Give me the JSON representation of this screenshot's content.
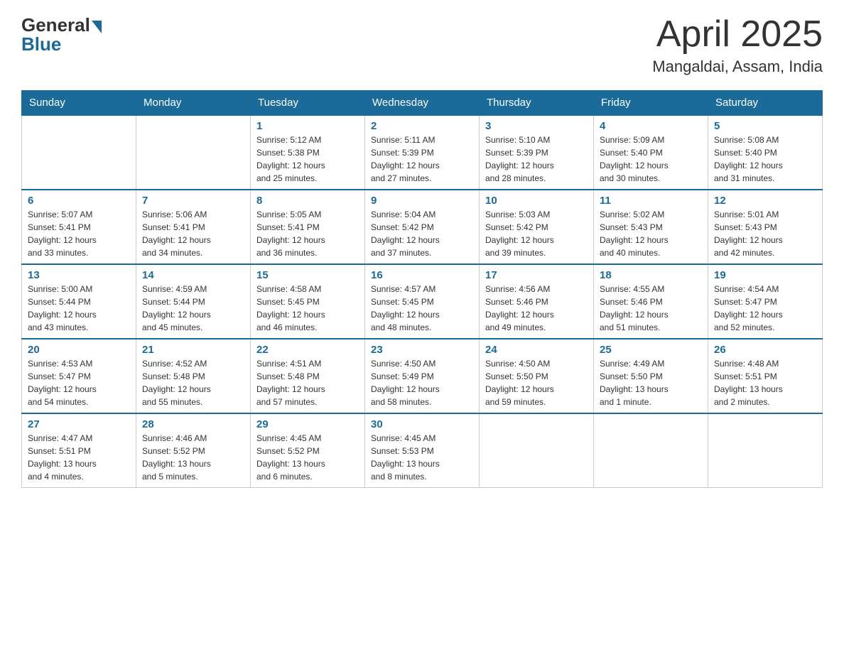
{
  "header": {
    "logo_general": "General",
    "logo_blue": "Blue",
    "title": "April 2025",
    "subtitle": "Mangaldai, Assam, India"
  },
  "weekdays": [
    "Sunday",
    "Monday",
    "Tuesday",
    "Wednesday",
    "Thursday",
    "Friday",
    "Saturday"
  ],
  "weeks": [
    [
      {
        "day": "",
        "info": ""
      },
      {
        "day": "",
        "info": ""
      },
      {
        "day": "1",
        "info": "Sunrise: 5:12 AM\nSunset: 5:38 PM\nDaylight: 12 hours\nand 25 minutes."
      },
      {
        "day": "2",
        "info": "Sunrise: 5:11 AM\nSunset: 5:39 PM\nDaylight: 12 hours\nand 27 minutes."
      },
      {
        "day": "3",
        "info": "Sunrise: 5:10 AM\nSunset: 5:39 PM\nDaylight: 12 hours\nand 28 minutes."
      },
      {
        "day": "4",
        "info": "Sunrise: 5:09 AM\nSunset: 5:40 PM\nDaylight: 12 hours\nand 30 minutes."
      },
      {
        "day": "5",
        "info": "Sunrise: 5:08 AM\nSunset: 5:40 PM\nDaylight: 12 hours\nand 31 minutes."
      }
    ],
    [
      {
        "day": "6",
        "info": "Sunrise: 5:07 AM\nSunset: 5:41 PM\nDaylight: 12 hours\nand 33 minutes."
      },
      {
        "day": "7",
        "info": "Sunrise: 5:06 AM\nSunset: 5:41 PM\nDaylight: 12 hours\nand 34 minutes."
      },
      {
        "day": "8",
        "info": "Sunrise: 5:05 AM\nSunset: 5:41 PM\nDaylight: 12 hours\nand 36 minutes."
      },
      {
        "day": "9",
        "info": "Sunrise: 5:04 AM\nSunset: 5:42 PM\nDaylight: 12 hours\nand 37 minutes."
      },
      {
        "day": "10",
        "info": "Sunrise: 5:03 AM\nSunset: 5:42 PM\nDaylight: 12 hours\nand 39 minutes."
      },
      {
        "day": "11",
        "info": "Sunrise: 5:02 AM\nSunset: 5:43 PM\nDaylight: 12 hours\nand 40 minutes."
      },
      {
        "day": "12",
        "info": "Sunrise: 5:01 AM\nSunset: 5:43 PM\nDaylight: 12 hours\nand 42 minutes."
      }
    ],
    [
      {
        "day": "13",
        "info": "Sunrise: 5:00 AM\nSunset: 5:44 PM\nDaylight: 12 hours\nand 43 minutes."
      },
      {
        "day": "14",
        "info": "Sunrise: 4:59 AM\nSunset: 5:44 PM\nDaylight: 12 hours\nand 45 minutes."
      },
      {
        "day": "15",
        "info": "Sunrise: 4:58 AM\nSunset: 5:45 PM\nDaylight: 12 hours\nand 46 minutes."
      },
      {
        "day": "16",
        "info": "Sunrise: 4:57 AM\nSunset: 5:45 PM\nDaylight: 12 hours\nand 48 minutes."
      },
      {
        "day": "17",
        "info": "Sunrise: 4:56 AM\nSunset: 5:46 PM\nDaylight: 12 hours\nand 49 minutes."
      },
      {
        "day": "18",
        "info": "Sunrise: 4:55 AM\nSunset: 5:46 PM\nDaylight: 12 hours\nand 51 minutes."
      },
      {
        "day": "19",
        "info": "Sunrise: 4:54 AM\nSunset: 5:47 PM\nDaylight: 12 hours\nand 52 minutes."
      }
    ],
    [
      {
        "day": "20",
        "info": "Sunrise: 4:53 AM\nSunset: 5:47 PM\nDaylight: 12 hours\nand 54 minutes."
      },
      {
        "day": "21",
        "info": "Sunrise: 4:52 AM\nSunset: 5:48 PM\nDaylight: 12 hours\nand 55 minutes."
      },
      {
        "day": "22",
        "info": "Sunrise: 4:51 AM\nSunset: 5:48 PM\nDaylight: 12 hours\nand 57 minutes."
      },
      {
        "day": "23",
        "info": "Sunrise: 4:50 AM\nSunset: 5:49 PM\nDaylight: 12 hours\nand 58 minutes."
      },
      {
        "day": "24",
        "info": "Sunrise: 4:50 AM\nSunset: 5:50 PM\nDaylight: 12 hours\nand 59 minutes."
      },
      {
        "day": "25",
        "info": "Sunrise: 4:49 AM\nSunset: 5:50 PM\nDaylight: 13 hours\nand 1 minute."
      },
      {
        "day": "26",
        "info": "Sunrise: 4:48 AM\nSunset: 5:51 PM\nDaylight: 13 hours\nand 2 minutes."
      }
    ],
    [
      {
        "day": "27",
        "info": "Sunrise: 4:47 AM\nSunset: 5:51 PM\nDaylight: 13 hours\nand 4 minutes."
      },
      {
        "day": "28",
        "info": "Sunrise: 4:46 AM\nSunset: 5:52 PM\nDaylight: 13 hours\nand 5 minutes."
      },
      {
        "day": "29",
        "info": "Sunrise: 4:45 AM\nSunset: 5:52 PM\nDaylight: 13 hours\nand 6 minutes."
      },
      {
        "day": "30",
        "info": "Sunrise: 4:45 AM\nSunset: 5:53 PM\nDaylight: 13 hours\nand 8 minutes."
      },
      {
        "day": "",
        "info": ""
      },
      {
        "day": "",
        "info": ""
      },
      {
        "day": "",
        "info": ""
      }
    ]
  ]
}
